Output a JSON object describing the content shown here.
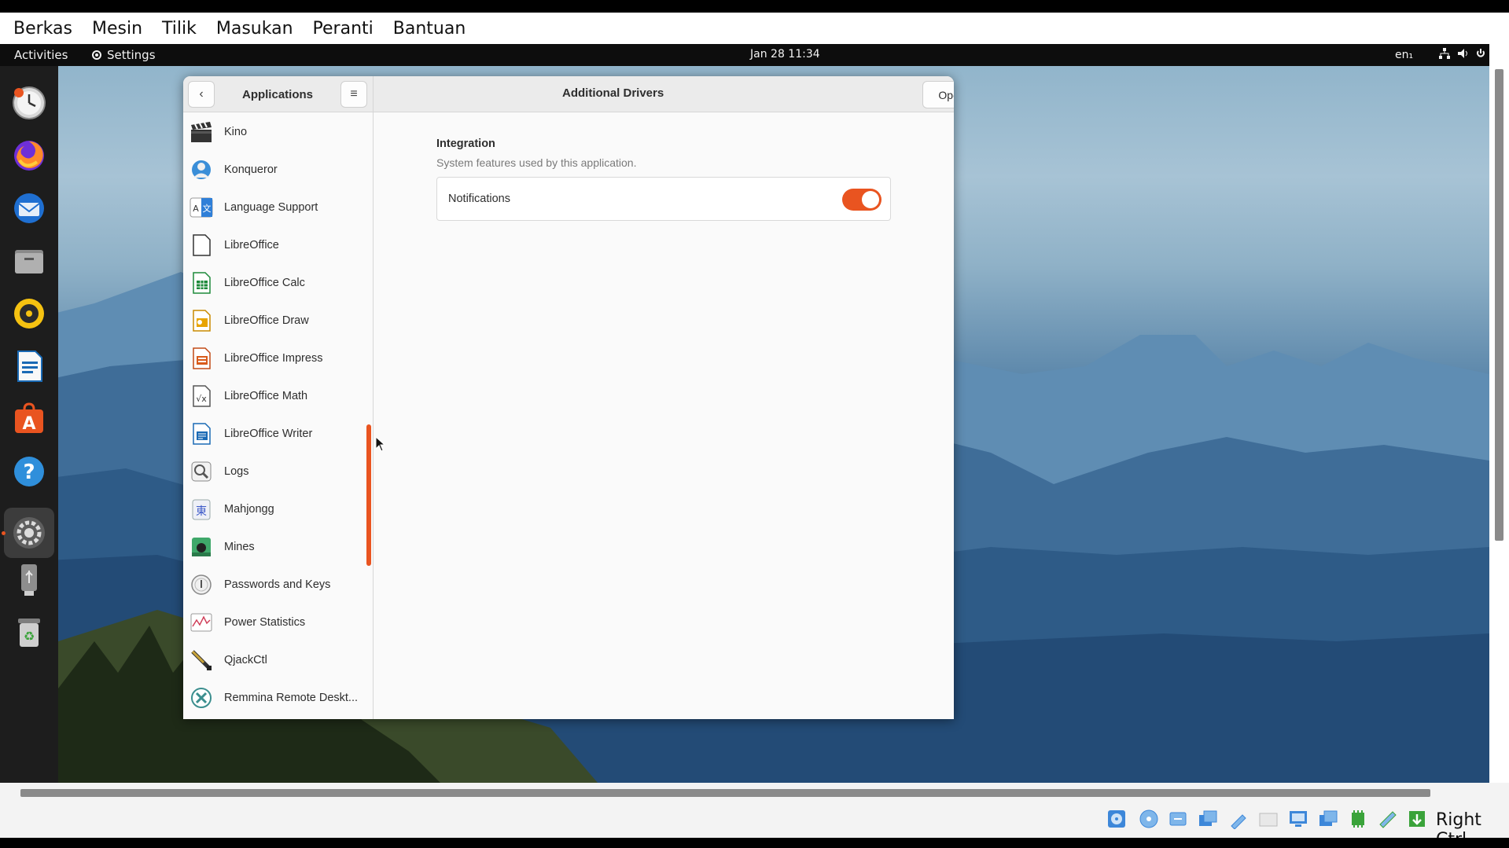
{
  "host_menu": [
    "Berkas",
    "Mesin",
    "Tilik",
    "Masukan",
    "Peranti",
    "Bantuan"
  ],
  "topbar": {
    "activities": "Activities",
    "app_name": "Settings",
    "clock": "Jan 28  11:34",
    "lang": "en₁"
  },
  "dock": {
    "items": [
      "clock-icon",
      "firefox-icon",
      "thunderbird-icon",
      "files-icon",
      "rhythmbox-icon",
      "writer-icon",
      "software-icon",
      "help-icon",
      "settings-icon",
      "usb-drive-icon",
      "trash-icon"
    ]
  },
  "sidebar": {
    "title": "Applications",
    "apps": [
      {
        "label": "Kino",
        "icon": "film-clapper-icon"
      },
      {
        "label": "Konqueror",
        "icon": "konqueror-icon"
      },
      {
        "label": "Language Support",
        "icon": "language-icon"
      },
      {
        "label": "LibreOffice",
        "icon": "libreoffice-icon"
      },
      {
        "label": "LibreOffice Calc",
        "icon": "calc-icon"
      },
      {
        "label": "LibreOffice Draw",
        "icon": "draw-icon"
      },
      {
        "label": "LibreOffice Impress",
        "icon": "impress-icon"
      },
      {
        "label": "LibreOffice Math",
        "icon": "math-icon"
      },
      {
        "label": "LibreOffice Writer",
        "icon": "writer-icon"
      },
      {
        "label": "Logs",
        "icon": "logs-icon"
      },
      {
        "label": "Mahjongg",
        "icon": "mahjongg-icon"
      },
      {
        "label": "Mines",
        "icon": "mines-icon"
      },
      {
        "label": "Passwords and Keys",
        "icon": "passwords-icon"
      },
      {
        "label": "Power Statistics",
        "icon": "power-statistics-icon"
      },
      {
        "label": "QjackCtl",
        "icon": "qjackctl-icon"
      },
      {
        "label": "Remmina Remote Deskt...",
        "icon": "remmina-icon"
      }
    ]
  },
  "main": {
    "title": "Additional Drivers",
    "open_button": "Open in Software",
    "section_title": "Integration",
    "section_subtitle": "System features used by this application.",
    "notifications_label": "Notifications",
    "notifications_enabled": true
  },
  "statusbar": {
    "host_key": "Right Ctrl"
  },
  "colors": {
    "accent": "#e95420"
  }
}
